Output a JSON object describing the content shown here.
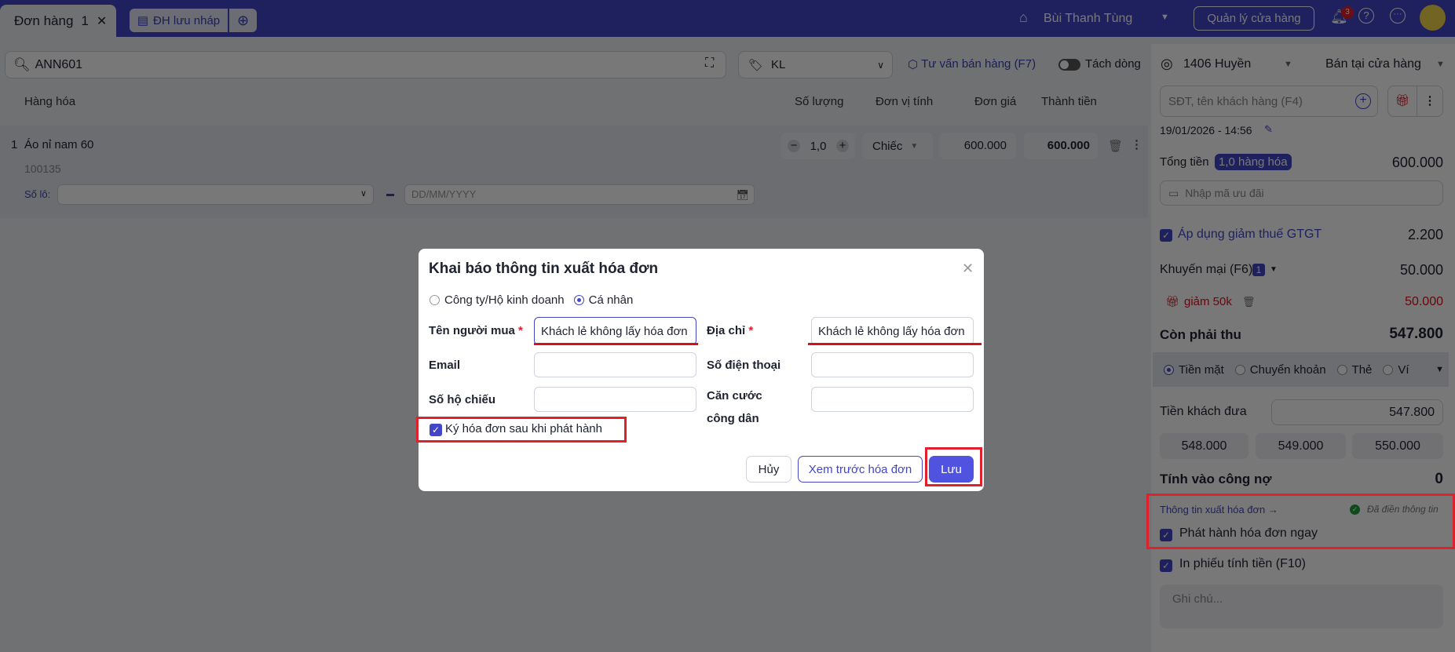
{
  "topbar": {
    "tab_label": "Đơn hàng",
    "tab_number": "1",
    "draft_label": "ĐH lưu nháp",
    "user": "Bùi Thanh Tùng",
    "manage_store": "Quản lý cửa hàng",
    "notif_count": "3"
  },
  "search": {
    "value": "ANN601"
  },
  "price_list": {
    "value": "KL"
  },
  "advice": "Tư vấn bán hàng (F7)",
  "split_lines": "Tách dòng",
  "table": {
    "headers": [
      "Hàng hóa",
      "Số lượng",
      "Đơn vị tính",
      "Đơn giá",
      "Thành tiền"
    ],
    "rows": [
      {
        "index": "1",
        "name": "Áo nỉ nam 60",
        "code": "100135",
        "qty": "1,0",
        "unit": "Chiếc",
        "price": "600.000",
        "total": "600.000",
        "lot_label": "Số lô:",
        "date_placeholder": "DD/MM/YYYY"
      }
    ]
  },
  "panel": {
    "staff": "1406 Huyền",
    "channel": "Bán tại cửa hàng",
    "customer_placeholder": "SĐT, tên khách hàng (F4)",
    "datetime": "19/01/2026 - 14:56",
    "total_label": "Tổng tiền",
    "total_badge": "1,0 hàng hóa",
    "total_value": "600.000",
    "voucher_placeholder": "Nhập mã ưu đãi",
    "vat_label": "Áp dụng giảm thuế GTGT",
    "vat_value": "2.200",
    "promo_label": "Khuyến mại (F6)",
    "promo_count": "1",
    "promo_value": "50.000",
    "promo_item": "giảm 50k",
    "promo_item_value": "50.000",
    "due_label": "Còn phải thu",
    "due_value": "547.800",
    "payment_methods": [
      "Tiền mặt",
      "Chuyển khoản",
      "Thẻ",
      "Ví"
    ],
    "paid_label": "Tiền khách đưa",
    "paid_value": "547.800",
    "quick_amounts": [
      "548.000",
      "549.000",
      "550.000"
    ],
    "debt_label": "Tính vào công nợ",
    "debt_value": "0",
    "invoice_link": "Thông tin xuất hóa đơn →",
    "invoice_status": "Đã điền thông tin",
    "issue_now": "Phát hành hóa đơn ngay",
    "print": "In phiếu tính tiền (F10)",
    "note_placeholder": "Ghi chú..."
  },
  "dialog": {
    "title": "Khai báo thông tin xuất hóa đơn",
    "type_company": "Công ty/Hộ kinh doanh",
    "type_person": "Cá nhân",
    "buyer_label": "Tên người mua",
    "buyer_value": "Khách lẻ không lấy hóa đơn",
    "address_label": "Địa chỉ",
    "address_value": "Khách lẻ không lấy hóa đơn",
    "email_label": "Email",
    "phone_label": "Số điện thoại",
    "passport_label": "Số hộ chiếu",
    "id_label": "Căn cước công dân",
    "sign_label": "Ký hóa đơn sau khi phát hành",
    "cancel": "Hủy",
    "preview": "Xem trước hóa đơn",
    "save": "Lưu",
    "required": "*"
  },
  "colors": {
    "primary": "#4346c8",
    "highlight": "#e0202a"
  }
}
